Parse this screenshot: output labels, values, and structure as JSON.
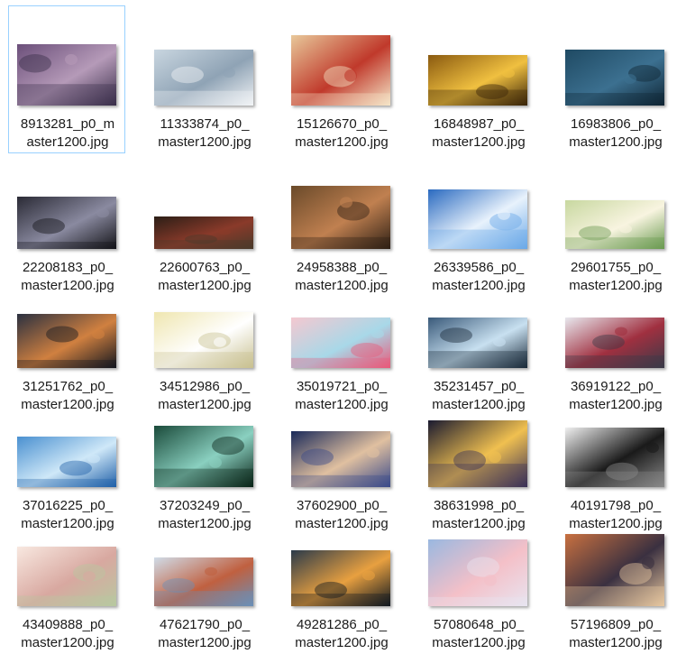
{
  "window": {
    "selected_index": 0
  },
  "files": [
    {
      "line1": "8913281_p0_m",
      "line2": "aster1200.jpg",
      "thumb": {
        "icon": "city-skyline-image-icon",
        "colors": [
          "#6b4f7a",
          "#b59ab8",
          "#3a2f4a"
        ]
      }
    },
    {
      "line1": "11333874_p0_",
      "line2": "master1200.jpg",
      "thumb": {
        "icon": "snowy-mountain-image-icon",
        "colors": [
          "#c9d6e0",
          "#8fa3b5",
          "#f2f4f6"
        ]
      }
    },
    {
      "line1": "15126670_p0_",
      "line2": "master1200.jpg",
      "thumb": {
        "icon": "food-table-image-icon",
        "colors": [
          "#e8c89a",
          "#c0392b",
          "#f5e6c8"
        ]
      }
    },
    {
      "line1": "16848987_p0_",
      "line2": "master1200.jpg",
      "thumb": {
        "icon": "golden-light-image-icon",
        "colors": [
          "#8a5a10",
          "#f0c040",
          "#3a2408"
        ]
      }
    },
    {
      "line1": "16983806_p0_",
      "line2": "master1200.jpg",
      "thumb": {
        "icon": "dark-sea-image-icon",
        "colors": [
          "#1f4a63",
          "#3c7090",
          "#0f2534"
        ]
      }
    },
    {
      "line1": "22208183_p0_",
      "line2": "master1200.jpg",
      "thumb": {
        "icon": "silhouettes-image-icon",
        "colors": [
          "#2a2a35",
          "#8a8aa0",
          "#151519"
        ]
      }
    },
    {
      "line1": "22600763_p0_",
      "line2": "master1200.jpg",
      "thumb": {
        "icon": "dark-flowers-image-icon",
        "colors": [
          "#2b1e16",
          "#8a3a2a",
          "#4a3a2a"
        ]
      }
    },
    {
      "line1": "24958388_p0_",
      "line2": "master1200.jpg",
      "thumb": {
        "icon": "crowd-feast-image-icon",
        "colors": [
          "#6a4a2a",
          "#c08050",
          "#2f2015"
        ]
      }
    },
    {
      "line1": "26339586_p0_",
      "line2": "master1200.jpg",
      "thumb": {
        "icon": "sky-clouds-image-icon",
        "colors": [
          "#2a6ac0",
          "#e8f2fc",
          "#6aa8e8"
        ]
      }
    },
    {
      "line1": "29601755_p0_",
      "line2": "master1200.jpg",
      "thumb": {
        "icon": "sunny-garden-image-icon",
        "colors": [
          "#c8d8a0",
          "#f8f4e0",
          "#6a9a50"
        ]
      }
    },
    {
      "line1": "31251762_p0_",
      "line2": "master1200.jpg",
      "thumb": {
        "icon": "dusk-figures-image-icon",
        "colors": [
          "#2a3040",
          "#d08040",
          "#151820"
        ]
      }
    },
    {
      "line1": "34512986_p0_",
      "line2": "master1200.jpg",
      "thumb": {
        "icon": "girl-sitting-image-icon",
        "colors": [
          "#efe6b0",
          "#ffffff",
          "#c8c090"
        ]
      }
    },
    {
      "line1": "35019721_p0_",
      "line2": "master1200.jpg",
      "thumb": {
        "icon": "pastel-room-image-icon",
        "colors": [
          "#f4c8d0",
          "#a8d8e8",
          "#e85a7a"
        ]
      }
    },
    {
      "line1": "35231457_p0_",
      "line2": "master1200.jpg",
      "thumb": {
        "icon": "crystal-ruins-image-icon",
        "colors": [
          "#3a5a7a",
          "#c8e0f0",
          "#1a2a3a"
        ]
      }
    },
    {
      "line1": "36919122_p0_",
      "line2": "master1200.jpg",
      "thumb": {
        "icon": "cluttered-room-image-icon",
        "colors": [
          "#e8e8ee",
          "#a03040",
          "#3a3a48"
        ]
      }
    },
    {
      "line1": "37016225_p0_",
      "line2": "master1200.jpg",
      "thumb": {
        "icon": "blue-window-image-icon",
        "colors": [
          "#4a90d0",
          "#cfe8f8",
          "#2060a8"
        ]
      }
    },
    {
      "line1": "37203249_p0_",
      "line2": "master1200.jpg",
      "thumb": {
        "icon": "forest-light-image-icon",
        "colors": [
          "#1a4a3a",
          "#8ad0c0",
          "#0a2418"
        ]
      }
    },
    {
      "line1": "37602900_p0_",
      "line2": "master1200.jpg",
      "thumb": {
        "icon": "birds-flight-image-icon",
        "colors": [
          "#1a2a5a",
          "#e0c0a0",
          "#3a4a8a"
        ]
      }
    },
    {
      "line1": "38631998_p0_",
      "line2": "master1200.jpg",
      "thumb": {
        "icon": "umbrella-night-image-icon",
        "colors": [
          "#1a1a30",
          "#f0c050",
          "#3a3058"
        ]
      }
    },
    {
      "line1": "40191798_p0_",
      "line2": "master1200.jpg",
      "thumb": {
        "icon": "black-coat-image-icon",
        "colors": [
          "#f0f0f0",
          "#1a1a1a",
          "#8a8a8a"
        ]
      }
    },
    {
      "line1": "43409888_p0_",
      "line2": "master1200.jpg",
      "thumb": {
        "icon": "floral-girl-image-icon",
        "colors": [
          "#f8e8e0",
          "#d8a8a0",
          "#b8c8a0"
        ]
      }
    },
    {
      "line1": "47621790_p0_",
      "line2": "master1200.jpg",
      "thumb": {
        "icon": "coastal-town-image-icon",
        "colors": [
          "#d0dce8",
          "#c06040",
          "#6a90b8"
        ]
      }
    },
    {
      "line1": "49281286_p0_",
      "line2": "master1200.jpg",
      "thumb": {
        "icon": "night-castle-image-icon",
        "colors": [
          "#2a3a4a",
          "#e8a040",
          "#101820"
        ]
      }
    },
    {
      "line1": "57080648_p0_",
      "line2": "master1200.jpg",
      "thumb": {
        "icon": "pink-clouds-image-icon",
        "colors": [
          "#9ab8e0",
          "#f4c0c8",
          "#e8e4f0"
        ]
      }
    },
    {
      "line1": "57196809_p0_",
      "line2": "master1200.jpg",
      "thumb": {
        "icon": "street-scene-image-icon",
        "colors": [
          "#c87040",
          "#3a3040",
          "#e8c8a0"
        ]
      }
    }
  ]
}
